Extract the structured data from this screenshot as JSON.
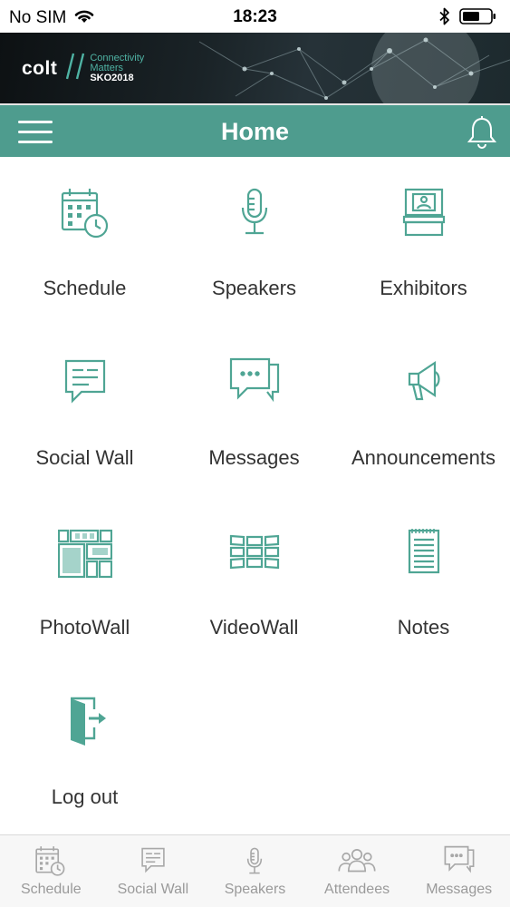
{
  "status_bar": {
    "carrier": "No SIM",
    "time": "18:23"
  },
  "banner": {
    "brand": "colt",
    "tagline_line1": "Connectivity",
    "tagline_line2": "Matters",
    "event": "SKO2018"
  },
  "navbar": {
    "title": "Home"
  },
  "grid": [
    {
      "label": "Schedule",
      "icon": "calendar-clock-icon"
    },
    {
      "label": "Speakers",
      "icon": "microphone-icon"
    },
    {
      "label": "Exhibitors",
      "icon": "exhibitor-booth-icon"
    },
    {
      "label": "Social Wall",
      "icon": "speech-bubble-icon"
    },
    {
      "label": "Messages",
      "icon": "chat-bubbles-icon"
    },
    {
      "label": "Announcements",
      "icon": "megaphone-icon"
    },
    {
      "label": "PhotoWall",
      "icon": "photo-grid-icon"
    },
    {
      "label": "VideoWall",
      "icon": "video-wall-icon"
    },
    {
      "label": "Notes",
      "icon": "notepad-icon"
    },
    {
      "label": "Log out",
      "icon": "logout-door-icon"
    }
  ],
  "tabbar": [
    {
      "label": "Schedule",
      "icon": "calendar-clock-icon"
    },
    {
      "label": "Social Wall",
      "icon": "speech-bubble-icon"
    },
    {
      "label": "Speakers",
      "icon": "microphone-icon"
    },
    {
      "label": "Attendees",
      "icon": "people-icon"
    },
    {
      "label": "Messages",
      "icon": "chat-bubbles-icon"
    }
  ],
  "colors": {
    "accent": "#4e9c8e",
    "icon": "#4fa594",
    "tab_icon": "#a8a8a8"
  }
}
